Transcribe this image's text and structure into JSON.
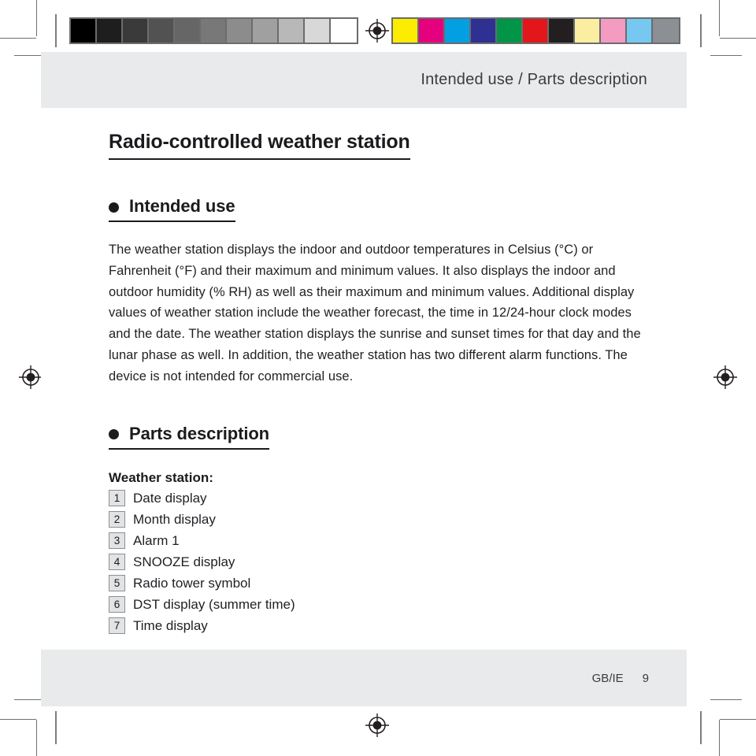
{
  "print_marks": {
    "grayscale_swatches": [
      "#000000",
      "#1e1e1e",
      "#3a3a3a",
      "#525252",
      "#666666",
      "#787878",
      "#8c8c8c",
      "#a0a0a0",
      "#b8b8b8",
      "#d8d8d8",
      "#ffffff"
    ],
    "color_swatches": [
      "#fced00",
      "#e5007d",
      "#029fe3",
      "#2e3192",
      "#009547",
      "#e3161c",
      "#231f20",
      "#fbeea0",
      "#f49bc1",
      "#76c8f0",
      "#8c8f93"
    ],
    "registration_mark_name": "registration-target",
    "crop_mark_name": "crop-mark"
  },
  "header": {
    "title": "Intended use / Parts description"
  },
  "document": {
    "title": "Radio-controlled weather station"
  },
  "sections": [
    {
      "heading": "Intended use",
      "body": "The weather station displays the indoor and outdoor temperatures in Celsius (°C) or Fahrenheit (°F) and their maximum and minimum values. It also displays the indoor and outdoor humidity (% RH) as well as their maximum and minimum values. Additional display values of weather station include the weather forecast, the time in 12/24-hour clock modes and the date. The weather station displays the sunrise and sunset times for that day and the lunar phase as well. In addition, the weather station has two different alarm functions. The device is not intended for commercial use."
    },
    {
      "heading": "Parts description",
      "subheading": "Weather station:",
      "parts": [
        {
          "number": "1",
          "label": "Date display"
        },
        {
          "number": "2",
          "label": "Month display"
        },
        {
          "number": "3",
          "label": "Alarm 1"
        },
        {
          "number": "4",
          "label": "SNOOZE display"
        },
        {
          "number": "5",
          "label": "Radio tower symbol"
        },
        {
          "number": "6",
          "label": "DST display (summer time)"
        },
        {
          "number": "7",
          "label": "Time display"
        }
      ]
    }
  ],
  "footer": {
    "locale": "GB/IE",
    "page_number": "9"
  }
}
